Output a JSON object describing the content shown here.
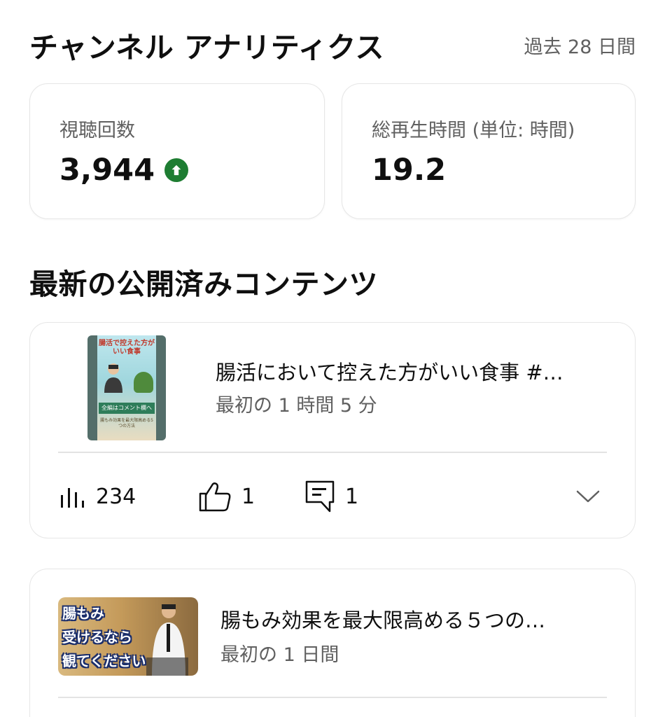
{
  "header": {
    "title": "チャンネル アナリティクス",
    "period": "過去 28 日間"
  },
  "stats": {
    "views": {
      "label": "視聴回数",
      "value": "3,944",
      "trend": "up"
    },
    "watch_time": {
      "label": "総再生時間 (単位: 時間)",
      "value": "19.2"
    }
  },
  "latest": {
    "section_title": "最新の公開済みコンテンツ",
    "items": [
      {
        "title": "腸活において控えた方がいい食事 #…",
        "subtitle": "最初の 1 時間 5 分",
        "views": "234",
        "likes": "1",
        "comments": "1",
        "thumb_texts": [
          "腸活で控えた方がいい食事",
          "全編はコメント欄へ",
          "腸もみ効果を最大限高める5つの方法"
        ]
      },
      {
        "title": "腸もみ効果を最大限高める５つの…",
        "subtitle": "最初の 1 日間",
        "thumb_text": [
          "腸もみ",
          "受けるなら",
          "観てください"
        ]
      }
    ]
  },
  "colors": {
    "trend_up": "#1e7d32",
    "secondary_text": "#606060",
    "card_border": "#e6e6e6"
  },
  "icons": [
    "trend-up-icon",
    "views-bar-icon",
    "like-icon",
    "comment-icon",
    "chevron-down-icon"
  ]
}
